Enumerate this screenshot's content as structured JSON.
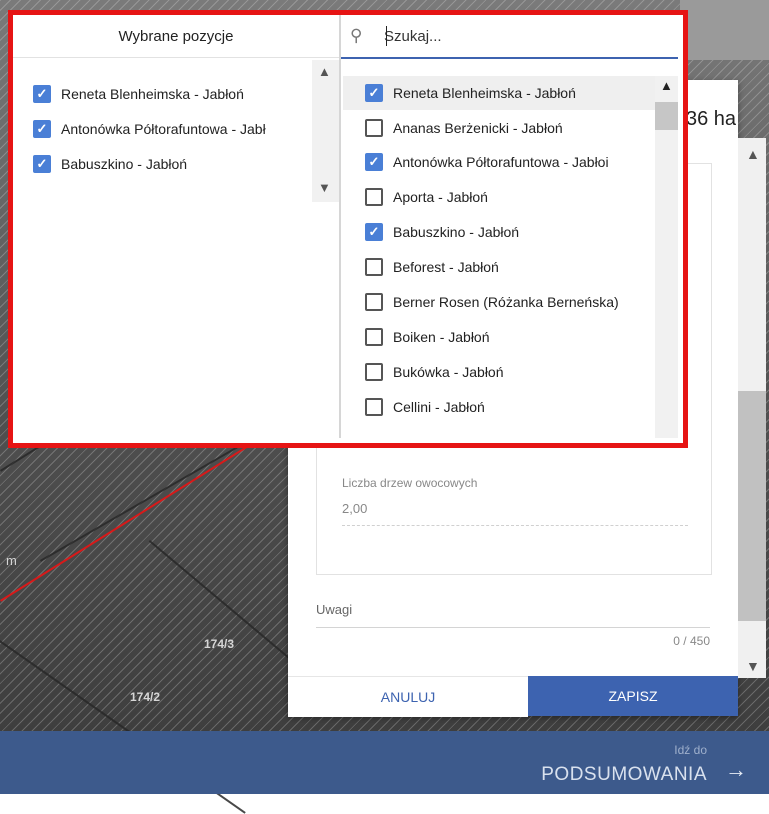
{
  "dialog": {
    "area_value": "36 ha",
    "tree_count_label": "Liczba drzew owocowych",
    "tree_count_value": "2,00",
    "notes_label": "Uwagi",
    "notes_counter": "0 / 450",
    "cancel_label": "ANULUJ",
    "save_label": "ZAPISZ"
  },
  "map": {
    "parcel_labels": [
      "174/3",
      "174/2"
    ],
    "scale_fragment": "m"
  },
  "footer": {
    "next_caption": "Idź do",
    "next_label": "PODSUMOWANIA"
  },
  "multiselect": {
    "selected_header": "Wybrane pozycje",
    "selected_items": [
      "Reneta Blenheimska - Jabłoń",
      "Antonówka Półtorafuntowa - Jabł",
      "Babuszkino - Jabłoń"
    ],
    "search_placeholder": "Szukaj...",
    "options": [
      {
        "label": "Reneta Blenheimska - Jabłoń",
        "checked": true
      },
      {
        "label": "Ananas Berżenicki - Jabłoń",
        "checked": false
      },
      {
        "label": "Antonówka Półtorafuntowa - Jabłoi",
        "checked": true
      },
      {
        "label": "Aporta - Jabłoń",
        "checked": false
      },
      {
        "label": "Babuszkino - Jabłoń",
        "checked": true
      },
      {
        "label": "Beforest - Jabłoń",
        "checked": false
      },
      {
        "label": "Berner Rosen (Różanka Berneńska)",
        "checked": false
      },
      {
        "label": "Boiken - Jabłoń",
        "checked": false
      },
      {
        "label": "Bukówka - Jabłoń",
        "checked": false
      },
      {
        "label": "Cellini - Jabłoń",
        "checked": false
      }
    ]
  },
  "colors": {
    "accent": "#3d63b0",
    "highlight_border": "#e61414",
    "checkbox_checked": "#4a7fd6",
    "footer_bar": "#3d5a8c"
  }
}
